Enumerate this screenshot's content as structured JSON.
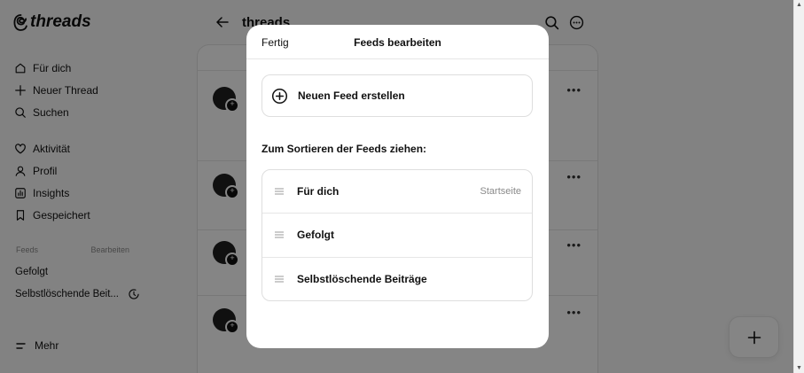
{
  "brand": {
    "name": "threads"
  },
  "sidebar": {
    "items": [
      {
        "label": "Für dich",
        "icon": "home-icon"
      },
      {
        "label": "Neuer Thread",
        "icon": "plus-icon"
      },
      {
        "label": "Suchen",
        "icon": "search-icon"
      },
      {
        "label": "Aktivität",
        "icon": "heart-icon"
      },
      {
        "label": "Profil",
        "icon": "user-icon"
      },
      {
        "label": "Insights",
        "icon": "chart-icon"
      },
      {
        "label": "Gespeichert",
        "icon": "bookmark-icon"
      }
    ],
    "feeds_heading": "Feeds",
    "feeds_edit": "Bearbeiten",
    "feeds": [
      "Gefolgt",
      "Selbstlöschende Beit..."
    ],
    "more_label": "Mehr"
  },
  "topbar": {
    "title": "threads"
  },
  "modal": {
    "done_label": "Fertig",
    "title": "Feeds bearbeiten",
    "new_feed_label": "Neuen Feed erstellen",
    "sort_label": "Zum Sortieren der Feeds ziehen:",
    "feeds": [
      {
        "name": "Für dich",
        "tag": "Startseite"
      },
      {
        "name": "Gefolgt",
        "tag": ""
      },
      {
        "name": "Selbstlöschende Beiträge",
        "tag": ""
      }
    ]
  },
  "colors": {
    "overlay": "#000000",
    "modal_bg": "#ffffff",
    "muted_text": "#8a8a8a"
  }
}
